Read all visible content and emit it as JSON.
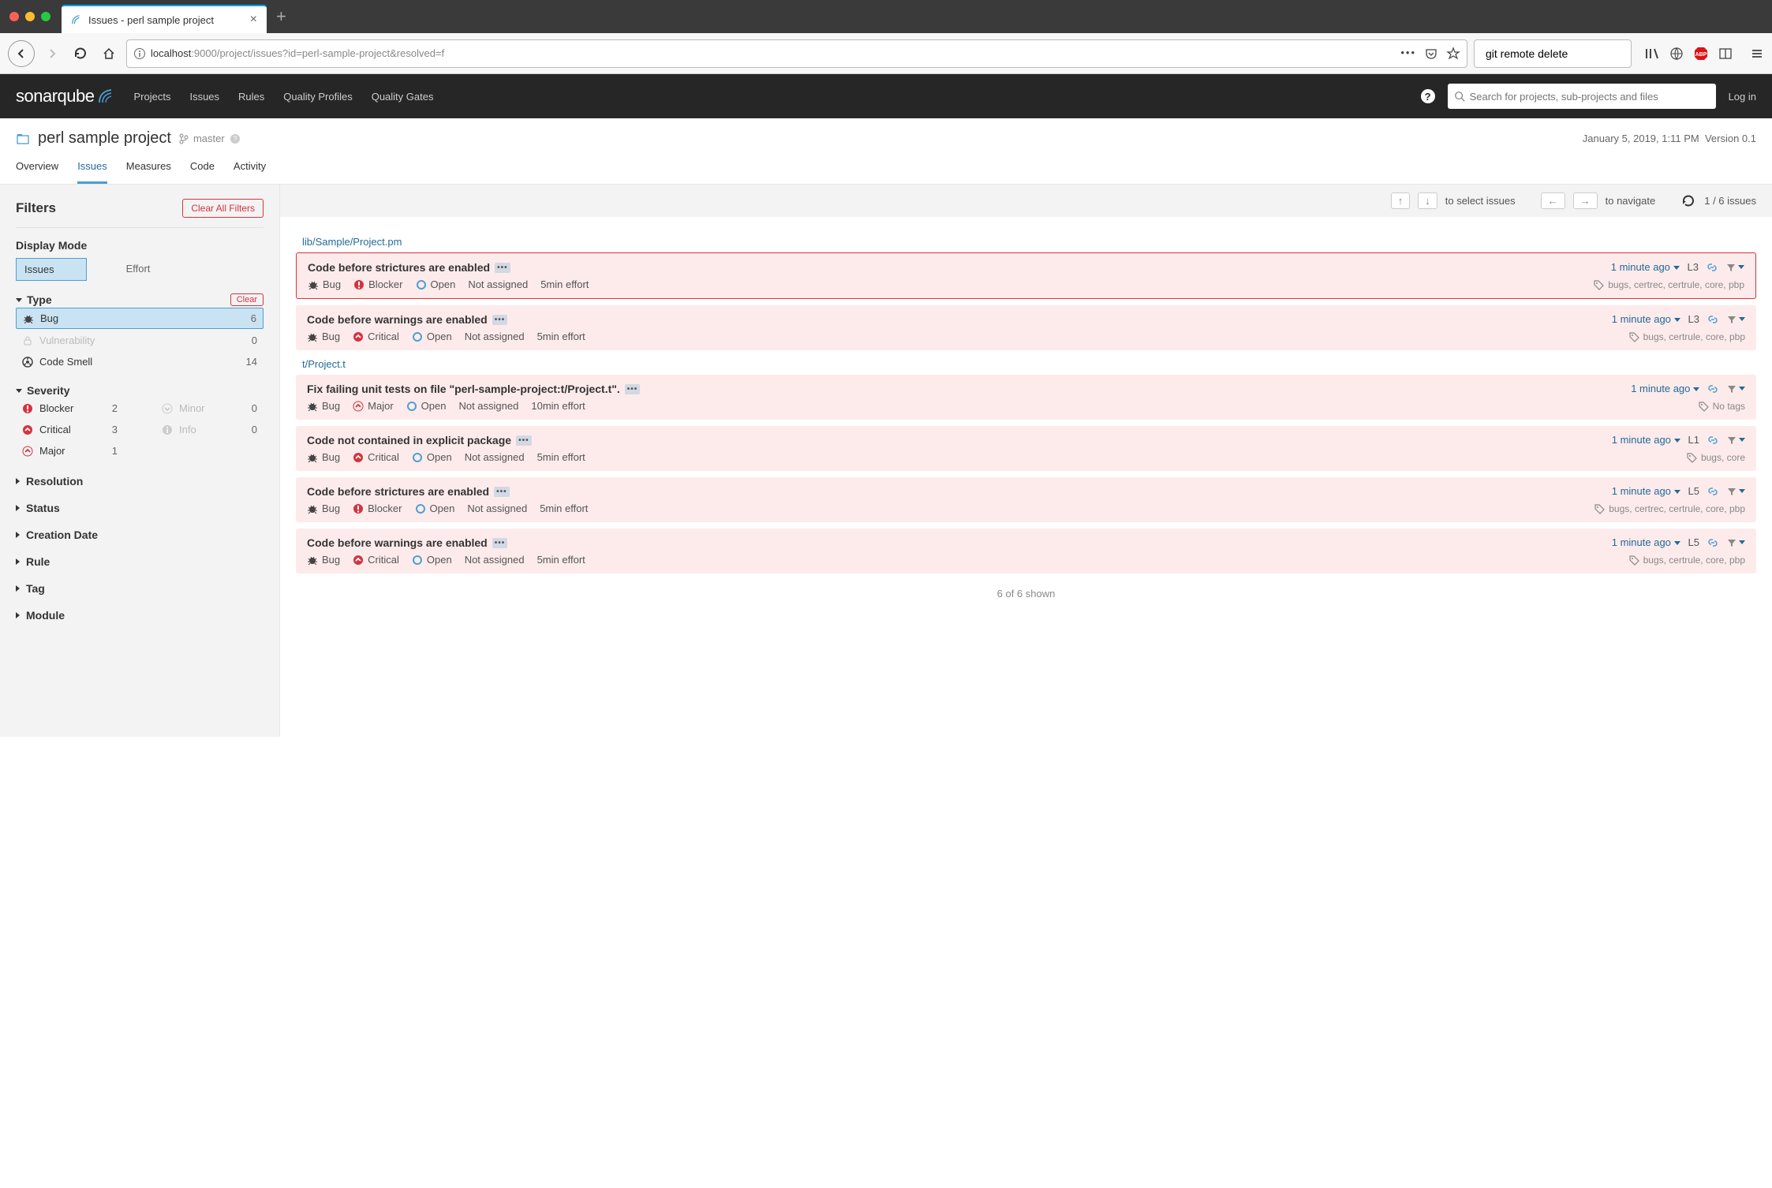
{
  "browser": {
    "tab_title": "Issues - perl sample project",
    "url_prefix": "localhost",
    "url_rest": ":9000/project/issues?id=perl-sample-project&resolved=f",
    "search_value": "git remote delete"
  },
  "topnav": {
    "items": [
      "Projects",
      "Issues",
      "Rules",
      "Quality Profiles",
      "Quality Gates"
    ],
    "search_placeholder": "Search for projects, sub-projects and files",
    "login": "Log in"
  },
  "project": {
    "name": "perl sample project",
    "branch": "master",
    "meta_date": "January 5, 2019, 1:11 PM",
    "meta_version": "Version 0.1",
    "tabs": [
      "Overview",
      "Issues",
      "Measures",
      "Code",
      "Activity"
    ],
    "active_tab": "Issues"
  },
  "filters": {
    "title": "Filters",
    "clear_all": "Clear All Filters",
    "display_mode_label": "Display Mode",
    "display_mode": {
      "issues": "Issues",
      "effort": "Effort"
    },
    "type": {
      "label": "Type",
      "clear": "Clear",
      "items": [
        {
          "icon": "bug",
          "label": "Bug",
          "count": "6",
          "active": true
        },
        {
          "icon": "vulnerability",
          "label": "Vulnerability",
          "count": "0",
          "disabled": true
        },
        {
          "icon": "codesmell",
          "label": "Code Smell",
          "count": "14"
        }
      ]
    },
    "severity": {
      "label": "Severity",
      "left": [
        {
          "icon": "blocker",
          "label": "Blocker",
          "count": "2"
        },
        {
          "icon": "critical",
          "label": "Critical",
          "count": "3"
        },
        {
          "icon": "major",
          "label": "Major",
          "count": "1"
        }
      ],
      "right": [
        {
          "icon": "minor",
          "label": "Minor",
          "count": "0",
          "disabled": true
        },
        {
          "icon": "info",
          "label": "Info",
          "count": "0",
          "disabled": true
        }
      ]
    },
    "collapsed": [
      "Resolution",
      "Status",
      "Creation Date",
      "Rule",
      "Tag",
      "Module"
    ]
  },
  "list_toolbar": {
    "select_hint": "to select issues",
    "navigate_hint": "to navigate",
    "counter": "1 / 6 issues"
  },
  "files": [
    {
      "path": "lib/Sample/Project.pm",
      "issues": [
        {
          "title": "Code before strictures are enabled",
          "type": "Bug",
          "severity": "Blocker",
          "sev_icon": "blocker",
          "status": "Open",
          "assignee": "Not assigned",
          "effort": "5min effort",
          "age": "1 minute ago",
          "line": "L3",
          "tags": "bugs, certrec, certrule, core, pbp",
          "selected": true
        },
        {
          "title": "Code before warnings are enabled",
          "type": "Bug",
          "severity": "Critical",
          "sev_icon": "critical",
          "status": "Open",
          "assignee": "Not assigned",
          "effort": "5min effort",
          "age": "1 minute ago",
          "line": "L3",
          "tags": "bugs, certrule, core, pbp"
        }
      ]
    },
    {
      "path": "t/Project.t",
      "issues": [
        {
          "title": "Fix failing unit tests on file \"perl-sample-project:t/Project.t\".",
          "type": "Bug",
          "severity": "Major",
          "sev_icon": "major",
          "status": "Open",
          "assignee": "Not assigned",
          "effort": "10min effort",
          "age": "1 minute ago",
          "line": "",
          "tags": "No tags"
        },
        {
          "title": "Code not contained in explicit package",
          "type": "Bug",
          "severity": "Critical",
          "sev_icon": "critical",
          "status": "Open",
          "assignee": "Not assigned",
          "effort": "5min effort",
          "age": "1 minute ago",
          "line": "L1",
          "tags": "bugs, core"
        },
        {
          "title": "Code before strictures are enabled",
          "type": "Bug",
          "severity": "Blocker",
          "sev_icon": "blocker",
          "status": "Open",
          "assignee": "Not assigned",
          "effort": "5min effort",
          "age": "1 minute ago",
          "line": "L5",
          "tags": "bugs, certrec, certrule, core, pbp"
        },
        {
          "title": "Code before warnings are enabled",
          "type": "Bug",
          "severity": "Critical",
          "sev_icon": "critical",
          "status": "Open",
          "assignee": "Not assigned",
          "effort": "5min effort",
          "age": "1 minute ago",
          "line": "L5",
          "tags": "bugs, certrule, core, pbp"
        }
      ]
    }
  ],
  "shown_text": "6 of 6 shown"
}
